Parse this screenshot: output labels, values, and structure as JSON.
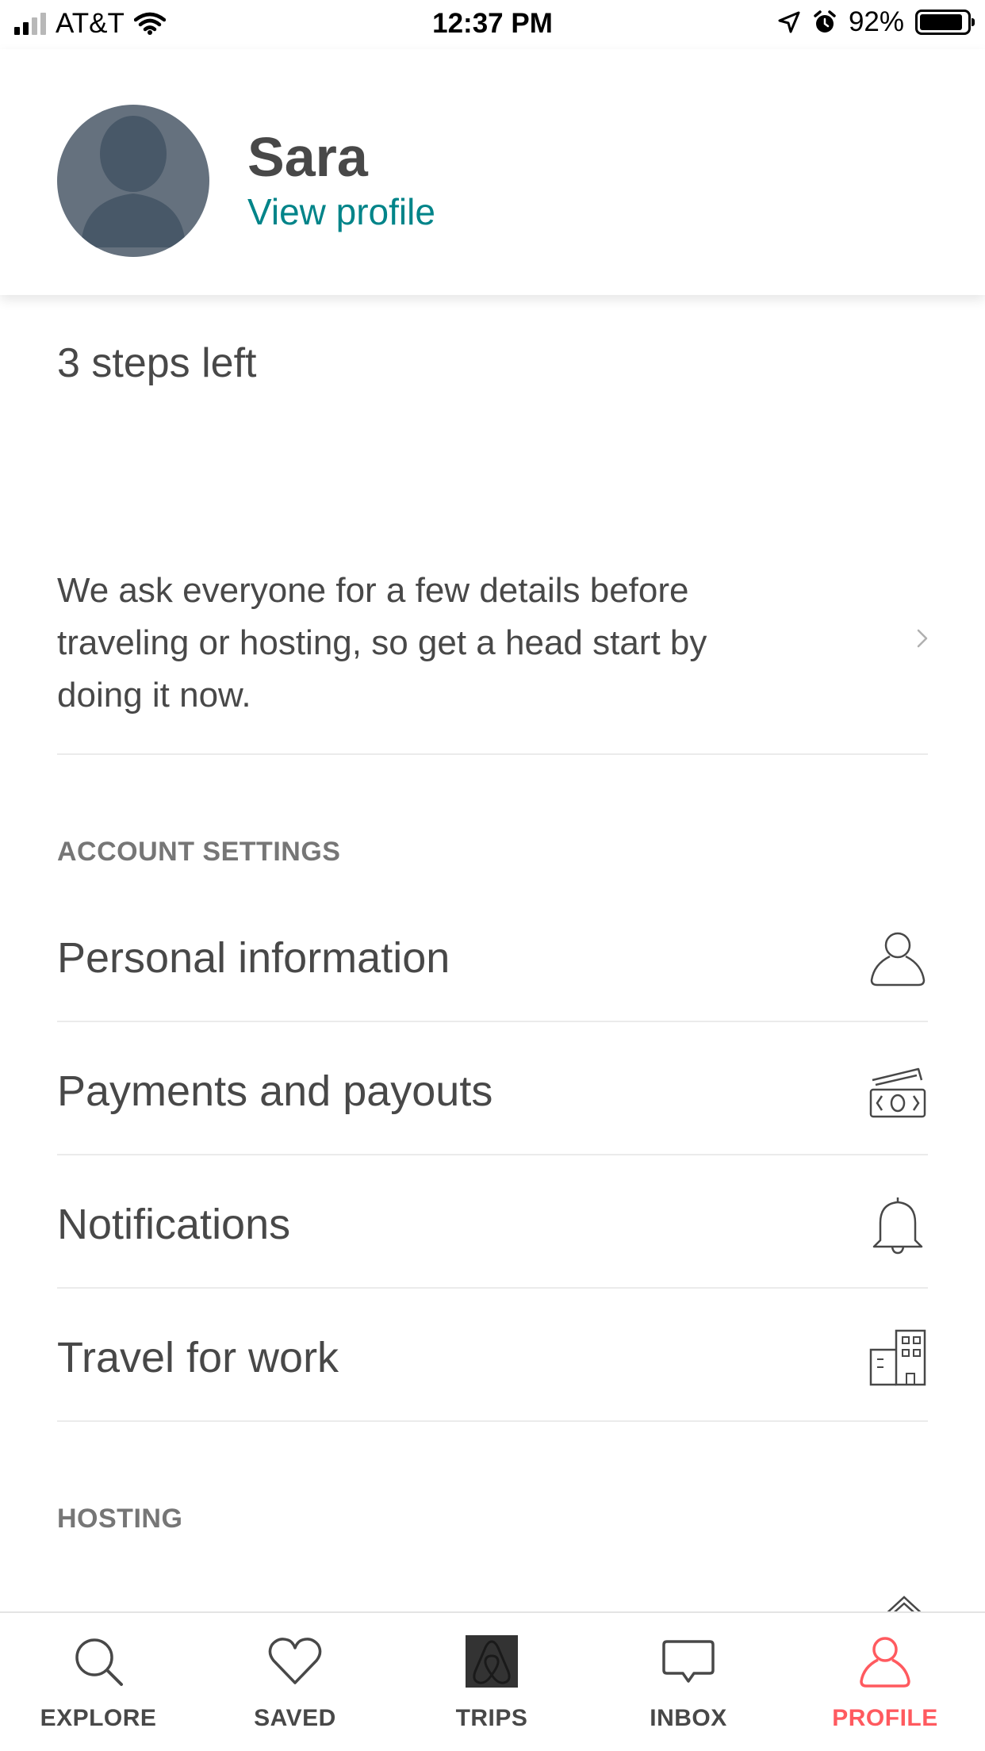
{
  "status_bar": {
    "carrier": "AT&T",
    "time": "12:37 PM",
    "battery": "92%",
    "battery_level": 0.92
  },
  "profile": {
    "name": "Sara",
    "view_profile_link": "View profile"
  },
  "steps": {
    "title": "3 steps left",
    "description": "We ask everyone for a few details before traveling or hosting, so get a head start by doing it now."
  },
  "account_settings": {
    "title": "ACCOUNT SETTINGS",
    "items": [
      {
        "label": "Personal information",
        "icon": "user-icon"
      },
      {
        "label": "Payments and payouts",
        "icon": "money-icon"
      },
      {
        "label": "Notifications",
        "icon": "bell-icon"
      },
      {
        "label": "Travel for work",
        "icon": "building-icon"
      }
    ]
  },
  "hosting": {
    "title": "HOSTING"
  },
  "tab_bar": {
    "active": "profile",
    "tabs": [
      {
        "id": "explore",
        "label": "EXPLORE",
        "icon": "search-icon"
      },
      {
        "id": "saved",
        "label": "SAVED",
        "icon": "heart-icon"
      },
      {
        "id": "trips",
        "label": "TRIPS",
        "icon": "airbnb-logo-icon"
      },
      {
        "id": "inbox",
        "label": "INBOX",
        "icon": "chat-bubble-icon"
      },
      {
        "id": "profile",
        "label": "PROFILE",
        "icon": "user-icon"
      }
    ]
  },
  "colors": {
    "accent_link": "#008489",
    "active_tab": "#ff5a5f",
    "text": "#484848",
    "section_title": "#767676",
    "divider": "#ebebeb"
  }
}
